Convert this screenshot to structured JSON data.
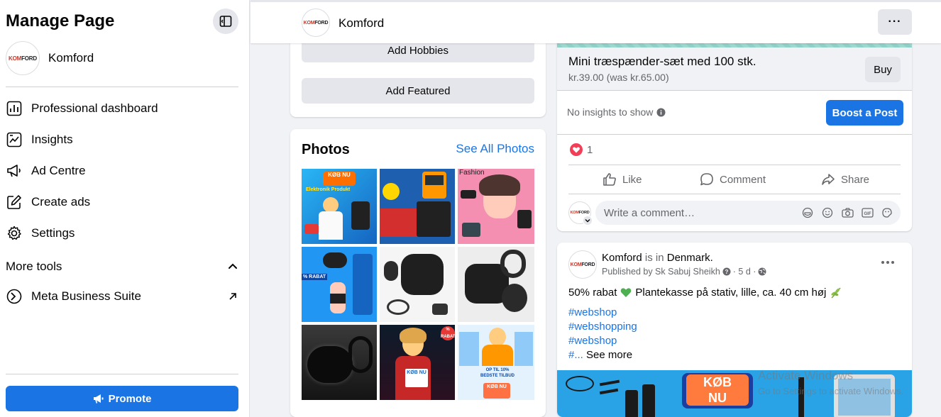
{
  "sidebar": {
    "title": "Manage Page",
    "page_name": "Komford",
    "nav": [
      {
        "label": "Professional dashboard",
        "icon": "dashboard-icon"
      },
      {
        "label": "Insights",
        "icon": "insights-icon"
      },
      {
        "label": "Ad Centre",
        "icon": "megaphone-icon"
      },
      {
        "label": "Create ads",
        "icon": "pencil-icon"
      },
      {
        "label": "Settings",
        "icon": "gear-icon"
      }
    ],
    "more_tools": "More tools",
    "meta_suite": "Meta Business Suite",
    "promote": "Promote"
  },
  "topbar": {
    "page_name": "Komford",
    "more": "···"
  },
  "logo": {
    "part1": "KOM",
    "part2": "FORD"
  },
  "left_column": {
    "add_hobbies": "Add Hobbies",
    "add_featured": "Add Featured",
    "photos_title": "Photos",
    "see_all": "See All Photos",
    "photos": [
      {
        "bg": "#1e88e5",
        "badge": "KØB NU",
        "caption": "Elektronik Produkt"
      },
      {
        "bg": "#1e5fb0",
        "badge": "",
        "caption": ""
      },
      {
        "bg": "#f48fb1",
        "badge": "",
        "caption": "Fashion"
      },
      {
        "bg": "#2196f3",
        "badge": "",
        "caption": "% RABAT"
      },
      {
        "bg": "#f2f2f2",
        "badge": "",
        "caption": ""
      },
      {
        "bg": "#ececec",
        "badge": "",
        "caption": ""
      },
      {
        "bg": "#2a2a2a",
        "badge": "",
        "caption": ""
      },
      {
        "bg": "#101820",
        "badge": "KØB NU",
        "caption": "% RABAT"
      },
      {
        "bg": "#e3f2fd",
        "badge": "KØB NU",
        "caption": "OP TIL 10% BEDSTE TILBUD"
      }
    ]
  },
  "product_post": {
    "title": "Mini træspænder-sæt med 100 stk.",
    "price": "kr.39.00 (was kr.65.00)",
    "buy": "Buy",
    "no_insights": "No insights to show",
    "boost": "Boost a Post",
    "reaction_count": "1",
    "like": "Like",
    "comment": "Comment",
    "share": "Share",
    "comment_placeholder": "Write a comment…"
  },
  "post2": {
    "author": "Komford",
    "is_in": "is in",
    "location": "Denmark",
    "published": "Published by Sk Sabuj Sheikh",
    "time": "· 5 d ·",
    "text_prefix": "50% rabat",
    "text_suffix": "Plantekasse på stativ, lille, ca. 40 cm høj",
    "hashtags": [
      "#webshop",
      "#webshopping",
      "#webshop"
    ],
    "see_more_prefix": "#...",
    "see_more": "See more",
    "banner_badge": "KØB NU"
  },
  "watermark": {
    "line1": "Activate Windows",
    "line2": "Go to Settings to activate Windows."
  },
  "colors": {
    "accent": "#1b74e4",
    "brand_red": "#c0392b",
    "like_red": "#f33e58"
  }
}
